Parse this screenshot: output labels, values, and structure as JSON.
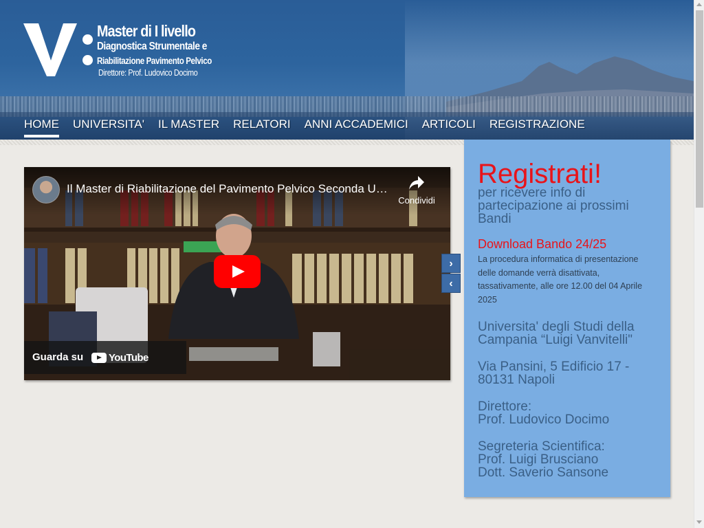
{
  "logo": {
    "line1": "Master di I livello",
    "line2": "Diagnostica Strumentale e",
    "line3": "Riabilitazione Pavimento Pelvico",
    "line4": "Direttore: Prof. Ludovico Docimo"
  },
  "nav": {
    "items": [
      "HOME",
      "UNIVERSITA'",
      "IL MASTER",
      "RELATORI",
      "ANNI ACCADEMICI",
      "ARTICOLI",
      "REGISTRAZIONE"
    ],
    "active": "HOME"
  },
  "video": {
    "title": "Il Master di Riabilitazione del Pavimento Pelvico Seconda Universita' di Napoli",
    "share_label": "Condividi",
    "watch_on_label": "Guarda su",
    "youtube_word": "YouTube"
  },
  "carousel": {
    "next_icon": "›",
    "prev_icon": "‹"
  },
  "sidebar": {
    "title": "Registrati!",
    "subtitle": "per ricevere info di partecipazione ai prossimi Bandi",
    "download_link": "Download Bando 24/25",
    "procedure_text": "La procedura informatica di presentazione delle domande verrà disattivata, tassativamente, alle ore 12.00 del 04 Aprile 2025",
    "university": "Universita' degli Studi della Campania “Luigi Vanvitelli\"",
    "address": "Via Pansini, 5 Edificio 17 - 80131 Napoli",
    "director_label": "Direttore:",
    "director_name": "Prof. Ludovico Docimo",
    "secretariat_label": "Segreteria Scientifica:",
    "secretariat_member1": "Prof. Luigi Brusciano",
    "secretariat_member2": "Dott. Saverio Sansone"
  },
  "colors": {
    "header_blue": "#2d649e",
    "sidebar_blue": "#7aade2",
    "accent_red": "#e8141a",
    "text_blue": "#3a5f86",
    "youtube_red": "#ff0000"
  },
  "icons": {
    "logo": "v-colon-logo",
    "share": "share-arrow-icon",
    "play": "youtube-play-icon",
    "next": "chevron-right-icon",
    "prev": "chevron-left-icon"
  }
}
